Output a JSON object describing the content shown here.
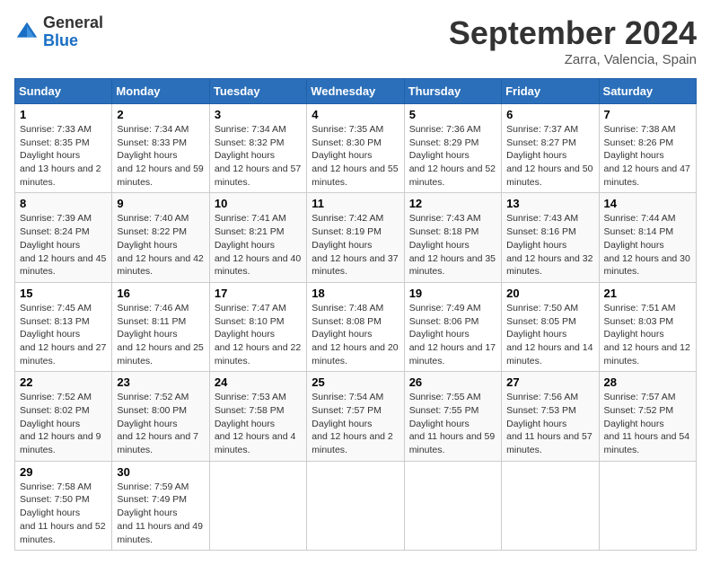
{
  "header": {
    "logo_general": "General",
    "logo_blue": "Blue",
    "month_title": "September 2024",
    "location": "Zarra, Valencia, Spain"
  },
  "calendar": {
    "days_of_week": [
      "Sunday",
      "Monday",
      "Tuesday",
      "Wednesday",
      "Thursday",
      "Friday",
      "Saturday"
    ],
    "weeks": [
      [
        null,
        null,
        null,
        null,
        null,
        null,
        null
      ]
    ],
    "cells": [
      {
        "day": 1,
        "col": 0,
        "sunrise": "7:33 AM",
        "sunset": "8:35 PM",
        "daylight": "13 hours and 2 minutes."
      },
      {
        "day": 2,
        "col": 1,
        "sunrise": "7:34 AM",
        "sunset": "8:33 PM",
        "daylight": "12 hours and 59 minutes."
      },
      {
        "day": 3,
        "col": 2,
        "sunrise": "7:34 AM",
        "sunset": "8:32 PM",
        "daylight": "12 hours and 57 minutes."
      },
      {
        "day": 4,
        "col": 3,
        "sunrise": "7:35 AM",
        "sunset": "8:30 PM",
        "daylight": "12 hours and 55 minutes."
      },
      {
        "day": 5,
        "col": 4,
        "sunrise": "7:36 AM",
        "sunset": "8:29 PM",
        "daylight": "12 hours and 52 minutes."
      },
      {
        "day": 6,
        "col": 5,
        "sunrise": "7:37 AM",
        "sunset": "8:27 PM",
        "daylight": "12 hours and 50 minutes."
      },
      {
        "day": 7,
        "col": 6,
        "sunrise": "7:38 AM",
        "sunset": "8:26 PM",
        "daylight": "12 hours and 47 minutes."
      },
      {
        "day": 8,
        "col": 0,
        "sunrise": "7:39 AM",
        "sunset": "8:24 PM",
        "daylight": "12 hours and 45 minutes."
      },
      {
        "day": 9,
        "col": 1,
        "sunrise": "7:40 AM",
        "sunset": "8:22 PM",
        "daylight": "12 hours and 42 minutes."
      },
      {
        "day": 10,
        "col": 2,
        "sunrise": "7:41 AM",
        "sunset": "8:21 PM",
        "daylight": "12 hours and 40 minutes."
      },
      {
        "day": 11,
        "col": 3,
        "sunrise": "7:42 AM",
        "sunset": "8:19 PM",
        "daylight": "12 hours and 37 minutes."
      },
      {
        "day": 12,
        "col": 4,
        "sunrise": "7:43 AM",
        "sunset": "8:18 PM",
        "daylight": "12 hours and 35 minutes."
      },
      {
        "day": 13,
        "col": 5,
        "sunrise": "7:43 AM",
        "sunset": "8:16 PM",
        "daylight": "12 hours and 32 minutes."
      },
      {
        "day": 14,
        "col": 6,
        "sunrise": "7:44 AM",
        "sunset": "8:14 PM",
        "daylight": "12 hours and 30 minutes."
      },
      {
        "day": 15,
        "col": 0,
        "sunrise": "7:45 AM",
        "sunset": "8:13 PM",
        "daylight": "12 hours and 27 minutes."
      },
      {
        "day": 16,
        "col": 1,
        "sunrise": "7:46 AM",
        "sunset": "8:11 PM",
        "daylight": "12 hours and 25 minutes."
      },
      {
        "day": 17,
        "col": 2,
        "sunrise": "7:47 AM",
        "sunset": "8:10 PM",
        "daylight": "12 hours and 22 minutes."
      },
      {
        "day": 18,
        "col": 3,
        "sunrise": "7:48 AM",
        "sunset": "8:08 PM",
        "daylight": "12 hours and 20 minutes."
      },
      {
        "day": 19,
        "col": 4,
        "sunrise": "7:49 AM",
        "sunset": "8:06 PM",
        "daylight": "12 hours and 17 minutes."
      },
      {
        "day": 20,
        "col": 5,
        "sunrise": "7:50 AM",
        "sunset": "8:05 PM",
        "daylight": "12 hours and 14 minutes."
      },
      {
        "day": 21,
        "col": 6,
        "sunrise": "7:51 AM",
        "sunset": "8:03 PM",
        "daylight": "12 hours and 12 minutes."
      },
      {
        "day": 22,
        "col": 0,
        "sunrise": "7:52 AM",
        "sunset": "8:02 PM",
        "daylight": "12 hours and 9 minutes."
      },
      {
        "day": 23,
        "col": 1,
        "sunrise": "7:52 AM",
        "sunset": "8:00 PM",
        "daylight": "12 hours and 7 minutes."
      },
      {
        "day": 24,
        "col": 2,
        "sunrise": "7:53 AM",
        "sunset": "7:58 PM",
        "daylight": "12 hours and 4 minutes."
      },
      {
        "day": 25,
        "col": 3,
        "sunrise": "7:54 AM",
        "sunset": "7:57 PM",
        "daylight": "12 hours and 2 minutes."
      },
      {
        "day": 26,
        "col": 4,
        "sunrise": "7:55 AM",
        "sunset": "7:55 PM",
        "daylight": "11 hours and 59 minutes."
      },
      {
        "day": 27,
        "col": 5,
        "sunrise": "7:56 AM",
        "sunset": "7:53 PM",
        "daylight": "11 hours and 57 minutes."
      },
      {
        "day": 28,
        "col": 6,
        "sunrise": "7:57 AM",
        "sunset": "7:52 PM",
        "daylight": "11 hours and 54 minutes."
      },
      {
        "day": 29,
        "col": 0,
        "sunrise": "7:58 AM",
        "sunset": "7:50 PM",
        "daylight": "11 hours and 52 minutes."
      },
      {
        "day": 30,
        "col": 1,
        "sunrise": "7:59 AM",
        "sunset": "7:49 PM",
        "daylight": "11 hours and 49 minutes."
      }
    ]
  }
}
